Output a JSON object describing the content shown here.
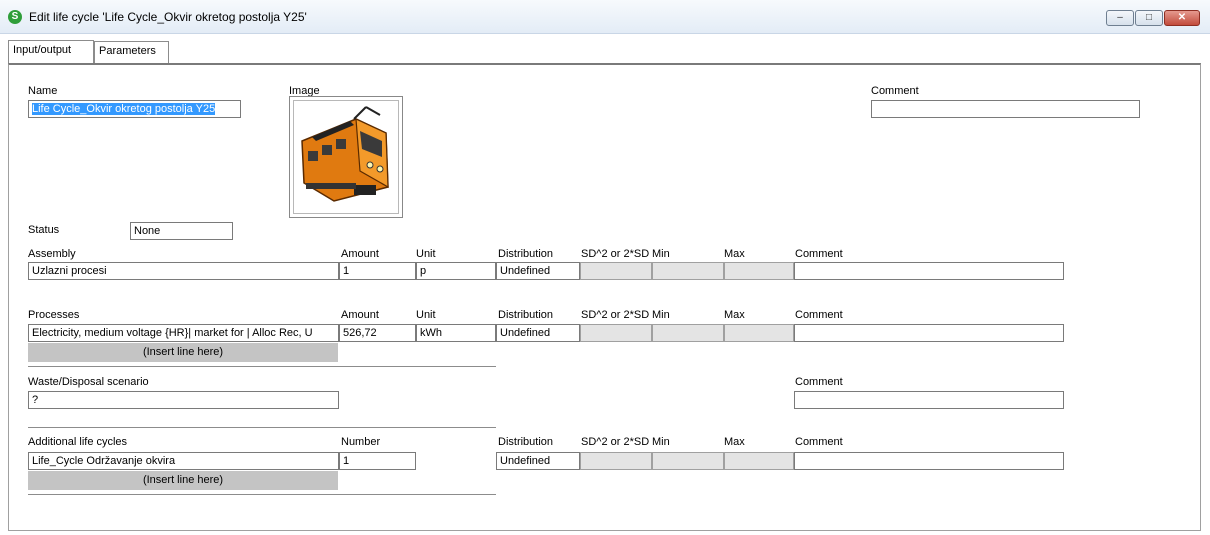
{
  "window": {
    "title": "Edit life cycle 'Life Cycle_Okvir okretog postolja Y25'",
    "buttons": [
      "–",
      "□",
      "✕"
    ],
    "app_icon": "simapro-icon"
  },
  "tabs": [
    {
      "label": "Input/output",
      "active": true
    },
    {
      "label": "Parameters",
      "active": false
    }
  ],
  "header": {
    "name_label": "Name",
    "name_value": "Life Cycle_Okvir okretog postolja Y25",
    "image_label": "Image",
    "image_icon": "locomotive-icon",
    "comment_label": "Comment",
    "comment_value": "",
    "status_label": "Status",
    "status_value": "None"
  },
  "columns": {
    "amount": "Amount",
    "unit": "Unit",
    "number": "Number",
    "distribution": "Distribution",
    "sd": "SD^2 or 2*SD",
    "min": "Min",
    "max": "Max",
    "comment": "Comment"
  },
  "assembly": {
    "label": "Assembly",
    "row": {
      "name": "Uzlazni procesi",
      "amount": "1",
      "unit": "p",
      "distribution": "Undefined"
    }
  },
  "processes": {
    "label": "Processes",
    "row": {
      "name": "Electricity, medium voltage {HR}| market for | Alloc Rec, U",
      "amount": "526,72",
      "unit": "kWh",
      "distribution": "Undefined"
    },
    "insert": "(Insert line here)"
  },
  "waste": {
    "label": "Waste/Disposal scenario",
    "value": "?",
    "comment_label": "Comment"
  },
  "additional": {
    "label": "Additional life cycles",
    "row": {
      "name": "Life_Cycle Održavanje okvira",
      "number": "1",
      "distribution": "Undefined"
    },
    "insert": "(Insert line here)"
  }
}
